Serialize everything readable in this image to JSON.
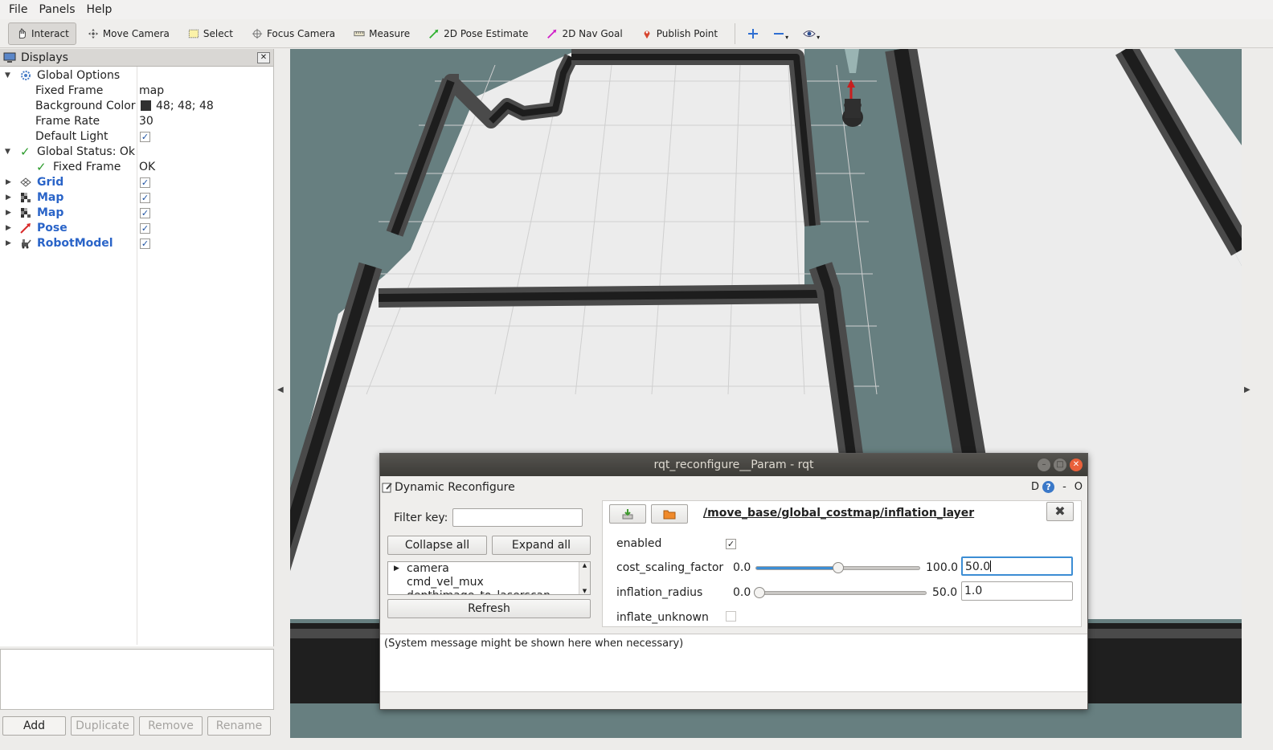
{
  "menu": {
    "items": [
      "File",
      "Panels",
      "Help"
    ]
  },
  "toolbar": {
    "interact": "Interact",
    "move_camera": "Move Camera",
    "select": "Select",
    "focus_camera": "Focus Camera",
    "measure": "Measure",
    "pose_estimate": "2D Pose Estimate",
    "nav_goal": "2D Nav Goal",
    "publish_point": "Publish Point"
  },
  "displays": {
    "title": "Displays",
    "global_options": "Global Options",
    "fixed_frame_label": "Fixed Frame",
    "fixed_frame_value": "map",
    "background_color_label": "Background Color",
    "background_color_value": "48; 48; 48",
    "background_color_swatch": "#303030",
    "frame_rate_label": "Frame Rate",
    "frame_rate_value": "30",
    "default_light_label": "Default Light",
    "global_status": "Global Status: Ok",
    "status_fixed_frame": "Fixed Frame",
    "status_fixed_frame_value": "OK",
    "items": [
      {
        "label": "Grid",
        "icon": "grid-icon"
      },
      {
        "label": "Map",
        "icon": "map-icon"
      },
      {
        "label": "Map",
        "icon": "map-icon"
      },
      {
        "label": "Pose",
        "icon": "pose-arrow-icon"
      },
      {
        "label": "RobotModel",
        "icon": "robot-model-icon"
      }
    ],
    "buttons": {
      "add": "Add",
      "duplicate": "Duplicate",
      "remove": "Remove",
      "rename": "Rename"
    }
  },
  "rqt": {
    "window_title": "rqt_reconfigure__Param - rqt",
    "plugin_title": "Dynamic Reconfigure",
    "plugin_buttons": "D",
    "filter_label": "Filter key:",
    "collapse_all": "Collapse all",
    "expand_all": "Expand all",
    "nodes": [
      "camera",
      "cmd_vel_mux",
      "depthimage_to_laserscan"
    ],
    "refresh": "Refresh",
    "node_path": "/move_base/global_costmap/inflation_layer",
    "params": {
      "enabled_label": "enabled",
      "enabled": true,
      "cost_label": "cost_scaling_factor",
      "cost_min": "0.0",
      "cost_max": "100.0",
      "cost_value": "50.0",
      "cost_fraction": 0.5,
      "radius_label": "inflation_radius",
      "radius_min": "0.0",
      "radius_max": "50.0",
      "radius_value": "1.0",
      "radius_fraction": 0.02,
      "unknown_label": "inflate_unknown",
      "unknown": false
    },
    "system_message": "(System message might be shown here when necessary)"
  },
  "colors": {
    "viewport_bg": "#677f80",
    "free_space": "#ececec",
    "wall": "#1d1d1d",
    "wall_inflation": "#4a4a4a",
    "accent": "#3c8dd4"
  }
}
